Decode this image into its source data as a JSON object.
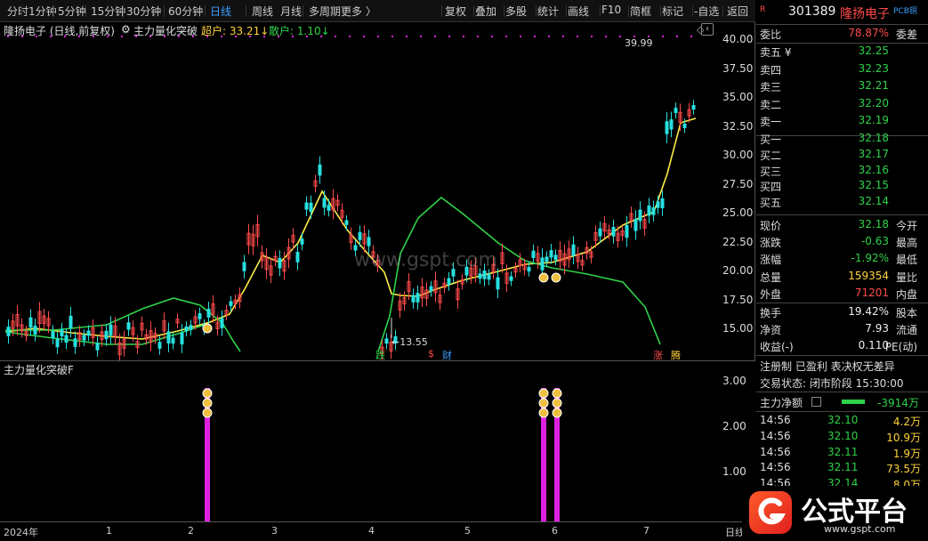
{
  "toolbar": {
    "left_items": [
      "分时",
      "1分钟",
      "5分钟",
      "15分钟",
      "30分钟",
      "60分钟",
      "日线",
      "周线",
      "月线",
      "多周期",
      "更多 〉"
    ],
    "active": "日线",
    "right_items": [
      "复权",
      "叠加",
      "多股",
      "统计",
      "画线",
      "F10",
      "简框",
      "标记",
      "-自选",
      "返回"
    ]
  },
  "main": {
    "stock_label": "隆扬电子 (日线,前复权)",
    "indicator_name": "主力量化突破",
    "super_label": "超户: 33.21↓",
    "retail_label": "散户: 1.10↓",
    "high_annot": "39.99",
    "low_annot": "←13.55",
    "markers": {
      "die": "跌",
      "cai": "财",
      "dollar": "$",
      "zhang": "涨",
      "teng": "腾"
    },
    "y_ticks": [
      "40.00",
      "37.50",
      "35.00",
      "32.50",
      "30.00",
      "27.50",
      "25.00",
      "22.50",
      "20.00",
      "17.50",
      "15.00"
    ]
  },
  "sub": {
    "indicator_name": "主力量化突破F",
    "y_ticks": [
      "3.00",
      "2.00",
      "1.00"
    ]
  },
  "xaxis": {
    "labels": [
      "2024年",
      "1",
      "2",
      "3",
      "4",
      "5",
      "6",
      "7",
      "日线"
    ]
  },
  "watermark": "www.gspt.com",
  "panel": {
    "code": "301389",
    "name": "隆扬电子",
    "tag": "PCB铜",
    "r_badge": "R",
    "weibi": {
      "label": "委比",
      "value": "78.87%",
      "ext": "委差"
    },
    "sells": [
      {
        "label": "卖五 ¥",
        "price": "32.25"
      },
      {
        "label": "卖四",
        "price": "32.23"
      },
      {
        "label": "卖三",
        "price": "32.21"
      },
      {
        "label": "卖二",
        "price": "32.20"
      },
      {
        "label": "卖一",
        "price": "32.19"
      }
    ],
    "buys": [
      {
        "label": "买一",
        "price": "32.18"
      },
      {
        "label": "买二",
        "price": "32.17"
      },
      {
        "label": "买三",
        "price": "32.16"
      },
      {
        "label": "买四",
        "price": "32.15"
      },
      {
        "label": "买五",
        "price": "32.14"
      }
    ],
    "stats1": [
      {
        "label": "现价",
        "value": "32.18",
        "ext": "今开",
        "color": "green"
      },
      {
        "label": "涨跌",
        "value": "-0.63",
        "ext": "最高",
        "color": "green"
      },
      {
        "label": "涨幅",
        "value": "-1.92%",
        "ext": "最低",
        "color": "green"
      },
      {
        "label": "总量",
        "value": "159354",
        "ext": "量比",
        "color": "yellow"
      },
      {
        "label": "外盘",
        "value": "71201",
        "ext": "内盘",
        "color": "red"
      }
    ],
    "stats2": [
      {
        "label": "换手",
        "value": "19.42%",
        "ext": "股本",
        "color": "white"
      },
      {
        "label": "净资",
        "value": "7.93",
        "ext": "流通",
        "color": "white"
      },
      {
        "label": "收益(-)",
        "value": "0.110",
        "ext": "PE(动)",
        "color": "white"
      }
    ],
    "reg_line": "注册制  已盈利  表决权无差异",
    "trade_status": "交易状态: 闭市阶段  15:30:00",
    "net_label": "主力净额",
    "net_value": "-3914万",
    "ticks": [
      {
        "time": "14:56",
        "price": "32.10",
        "vol": "4.2万"
      },
      {
        "time": "14:56",
        "price": "32.10",
        "vol": "10.9万"
      },
      {
        "time": "14:56",
        "price": "32.11",
        "vol": "1.9万"
      },
      {
        "time": "14:56",
        "price": "32.11",
        "vol": "73.5万"
      },
      {
        "time": "14:56",
        "price": "32.14",
        "vol": "8.0万"
      }
    ]
  },
  "logo": {
    "text": "公式平台",
    "sub": "www.gspt.com"
  },
  "colors": {
    "up": "#ff4b4b",
    "down": "#2fd34a",
    "ma": "#ffee44",
    "band": "#2fd34a",
    "magenta": "#e020e0",
    "accent": "#3aa0ff"
  }
}
